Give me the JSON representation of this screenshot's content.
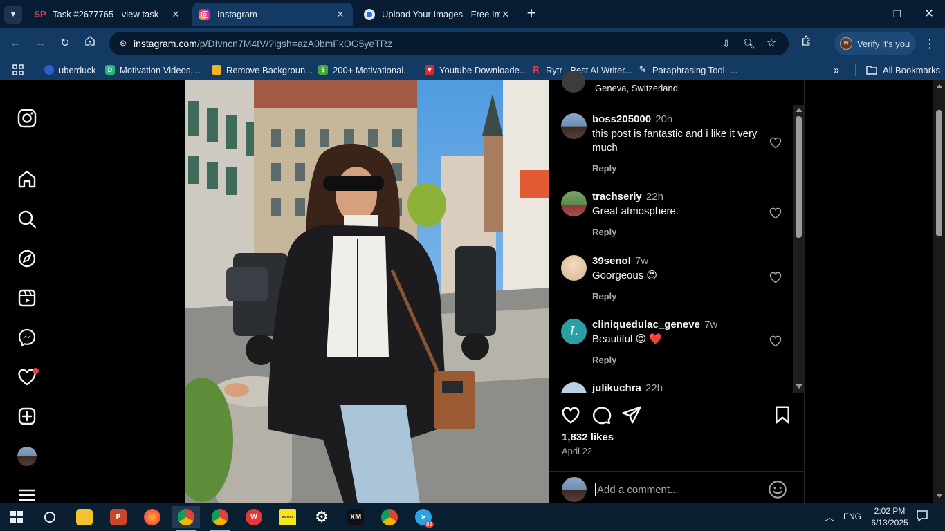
{
  "browser": {
    "tabs": [
      {
        "title": "Task #2677765 - view task",
        "favicon": "sp-logo",
        "active": false
      },
      {
        "title": "Instagram",
        "favicon": "instagram-logo",
        "active": true
      },
      {
        "title": "Upload Your Images - Free Imag",
        "favicon": "upload-logo",
        "active": false
      }
    ],
    "url_domain": "instagram.com",
    "url_path": "/p/DIvncn7M4tV/?igsh=azA0bmFkOG5yeTRz",
    "profile_chip": "Verify it's you",
    "bookmarks": [
      {
        "label": "uberduck",
        "color": "#2a60c8"
      },
      {
        "label": "Motivation Videos,...",
        "color": "#2bb57c"
      },
      {
        "label": "Remove Backgroun...",
        "color": "#f0b429"
      },
      {
        "label": "200+ Motivational...",
        "color": "#48a93a"
      },
      {
        "label": "Youtube Downloade...",
        "color": "#e3262b"
      },
      {
        "label": "Rytr - Best AI Writer...",
        "color": "#e63946"
      },
      {
        "label": "Paraphrasing Tool -...",
        "color": "#ffffff"
      }
    ],
    "all_bookmarks": "All Bookmarks"
  },
  "post": {
    "location": "Geneva, Switzerland",
    "comments": [
      {
        "user": "boss205000",
        "time": "20h",
        "text": "this post is fantastic and i like it very much",
        "reply": "Reply"
      },
      {
        "user": "trachseriy",
        "time": "22h",
        "text": "Great atmosphere.",
        "reply": "Reply"
      },
      {
        "user": "39senol",
        "time": "7w",
        "text": "Goorgeous 😍",
        "reply": "Reply"
      },
      {
        "user": "cliniquedulac_geneve",
        "time": "7w",
        "text": "Beautiful 😍 ❤️",
        "reply": "Reply"
      },
      {
        "user": "julikuchra",
        "time": "22h",
        "text": "",
        "reply": ""
      }
    ],
    "likes": "1,832 likes",
    "date": "April 22",
    "comment_placeholder": "Add a comment..."
  },
  "taskbar": {
    "language": "ENG",
    "time": "2:02 PM",
    "date": "6/13/2025",
    "telegram_badge": "82"
  },
  "colors": {
    "chrome_dark": "#081c34",
    "chrome_toolbar": "#133a63",
    "instagram_bg": "#000000",
    "notification_red": "#ff3040"
  }
}
